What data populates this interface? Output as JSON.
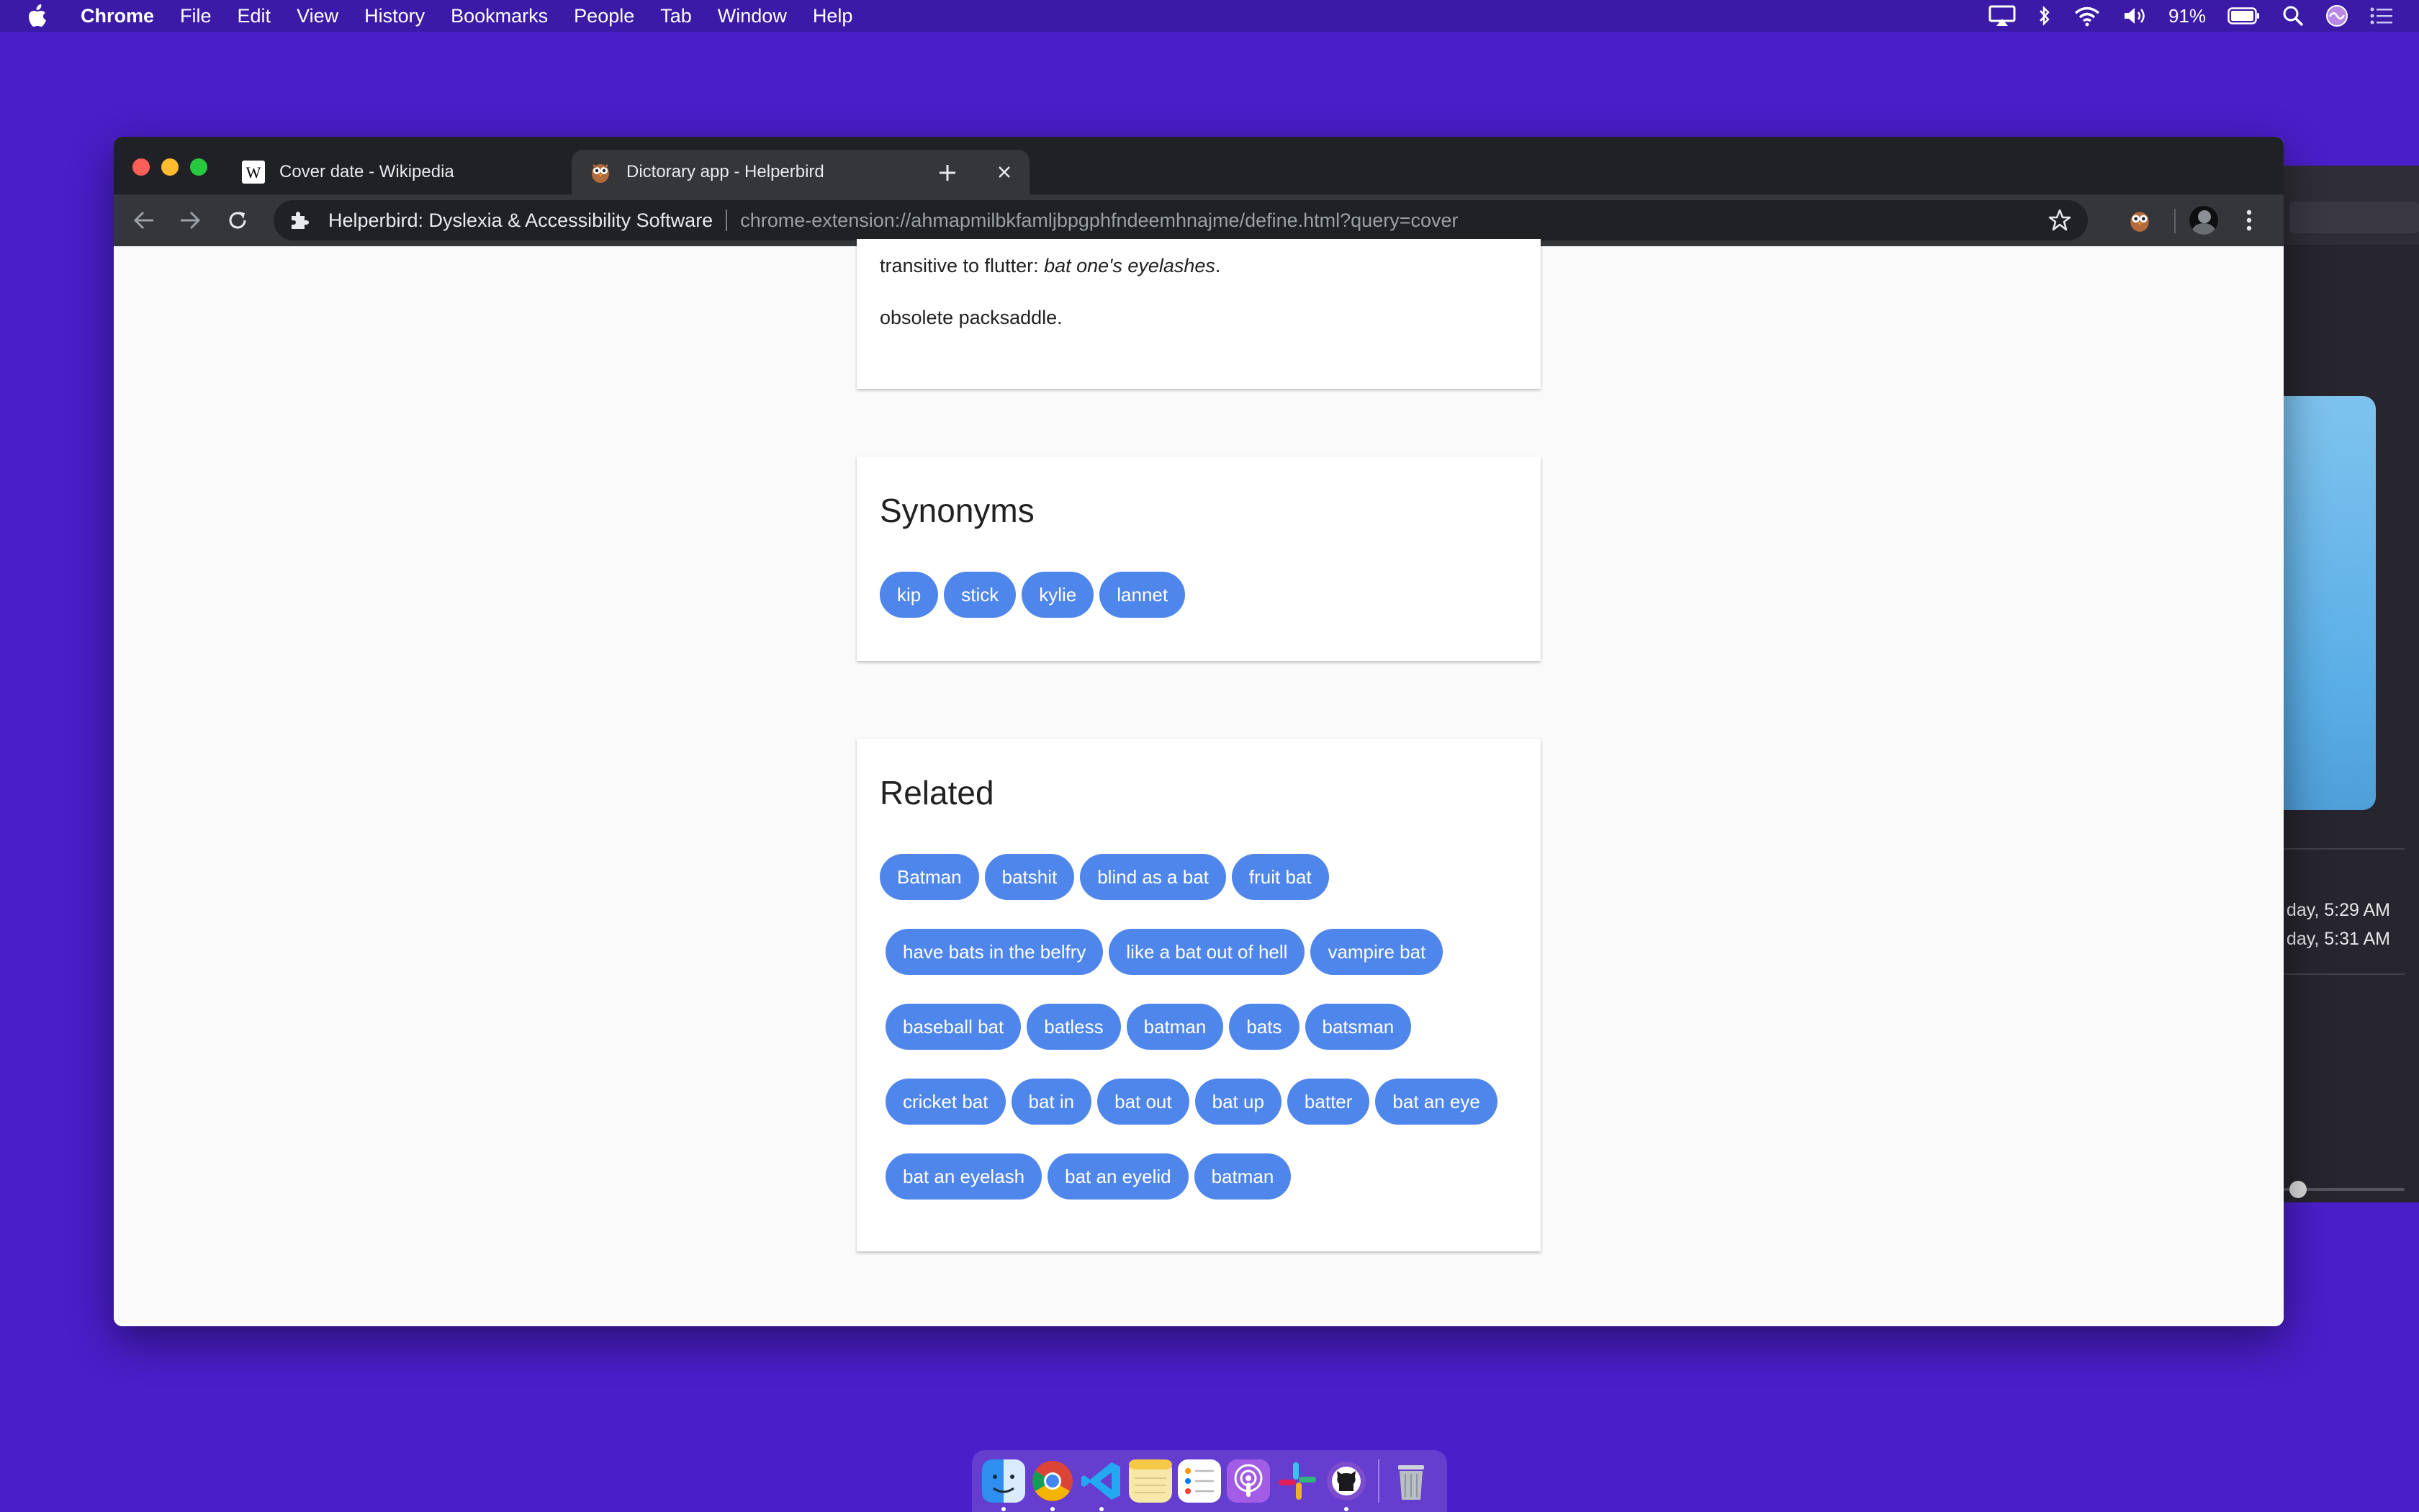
{
  "menubar": {
    "app_name": "Chrome",
    "items": [
      "File",
      "Edit",
      "View",
      "History",
      "Bookmarks",
      "People",
      "Tab",
      "Window",
      "Help"
    ],
    "battery": "91%"
  },
  "background_window": {
    "time_1": "day, 5:29 AM",
    "time_2": "day, 5:31 AM"
  },
  "browser": {
    "tabs": [
      {
        "title": "Cover date - Wikipedia",
        "favicon": "wikipedia-icon"
      },
      {
        "title": "Dictorary app - Helperbird",
        "favicon": "owl-icon"
      }
    ],
    "omnibox": {
      "origin": "Helperbird: Dyslexia & Accessibility Software",
      "url": "chrome-extension://ahmapmilbkfamljbpgphfndeemhnajme/define.html?query=cover"
    }
  },
  "definitions": {
    "line1_prefix": "transitive to flutter: ",
    "line1_example": "bat one's eyelashes",
    "line1_suffix": ".",
    "line2": "obsolete packsaddle."
  },
  "synonyms": {
    "title": "Synonyms",
    "chips": [
      "kip",
      "stick",
      "kylie",
      "lannet"
    ]
  },
  "related": {
    "title": "Related",
    "rows": [
      [
        "Batman",
        "batshit",
        "blind as a bat",
        "fruit bat"
      ],
      [
        "have bats in the belfry",
        "like a bat out of hell",
        "vampire bat"
      ],
      [
        "baseball bat",
        "batless",
        "batman",
        "bats",
        "batsman"
      ],
      [
        "cricket bat",
        "bat in",
        "bat out",
        "bat up",
        "batter",
        "bat an eye"
      ],
      [
        "bat an eyelash",
        "bat an eyelid",
        "batman"
      ]
    ]
  },
  "colors": {
    "desktop": "#4a1ec9",
    "chip": "#4f86ec",
    "tab_strip": "#202124",
    "toolbar": "#35363a"
  }
}
